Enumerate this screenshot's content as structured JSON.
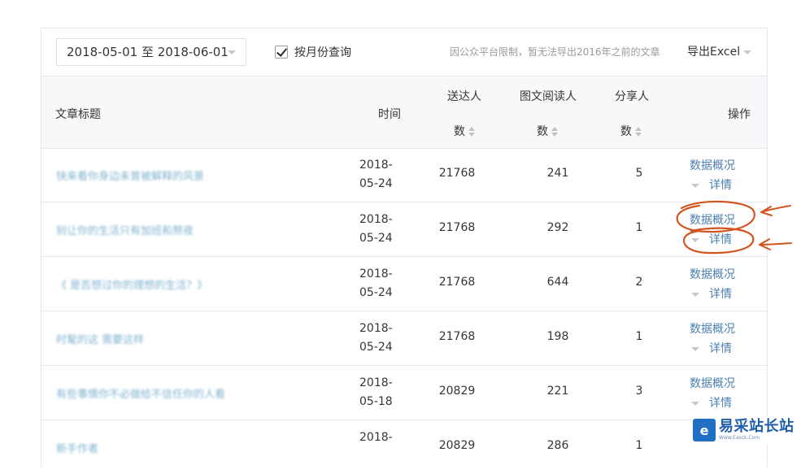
{
  "toolbar": {
    "date_range": "2018-05-01 至 2018-06-01",
    "month_query_label": "按月份查询",
    "month_query_checked": true,
    "notice": "因公众平台限制，暂无法导出2016年之前的文章",
    "export_label": "导出Excel"
  },
  "table": {
    "headers": {
      "title": "文章标题",
      "time": "时间",
      "delivered_line1": "送达人",
      "delivered_line2": "数",
      "readers_line1": "图文阅读人",
      "readers_line2": "数",
      "sharers_line1": "分享人",
      "sharers_line2": "数",
      "actions": "操作"
    },
    "rows": [
      {
        "title": "快来看你身边未曾被解释的风景",
        "date_line1": "2018-",
        "date_line2": "05-24",
        "delivered": "21768",
        "readers": "241",
        "sharers": "5",
        "overview": "数据概况",
        "detail": "详情"
      },
      {
        "title": "别让你的生活只有加班和熬夜",
        "date_line1": "2018-",
        "date_line2": "05-24",
        "delivered": "21768",
        "readers": "292",
        "sharers": "1",
        "overview": "数据概况",
        "detail": "详情"
      },
      {
        "title": "《    是否想过你的理想的生活？》",
        "date_line1": "2018-",
        "date_line2": "05-24",
        "delivered": "21768",
        "readers": "644",
        "sharers": "2",
        "overview": "数据概况",
        "detail": "详情"
      },
      {
        "title": "时髦的这              需要这样",
        "date_line1": "2018-",
        "date_line2": "05-24",
        "delivered": "21768",
        "readers": "198",
        "sharers": "1",
        "overview": "数据概况",
        "detail": "详情"
      },
      {
        "title": "有些事情你不必做给不信任你的人看",
        "date_line1": "2018-",
        "date_line2": "05-18",
        "delivered": "20829",
        "readers": "221",
        "sharers": "3",
        "overview": "数据概况",
        "detail": "详情"
      },
      {
        "title": "新手作者",
        "date_line1": "2018-",
        "date_line2": "",
        "delivered": "20829",
        "readers": "286",
        "sharers": "1",
        "overview": "",
        "detail": ""
      }
    ]
  },
  "watermark": {
    "logo": "e",
    "text": "易采站长站",
    "sub": "Www.Easck.Com"
  },
  "colors": {
    "link": "#4c7fb0",
    "annotation": "#d2541f",
    "header_bg": "#f6f8f9",
    "border": "#e7e7eb"
  }
}
